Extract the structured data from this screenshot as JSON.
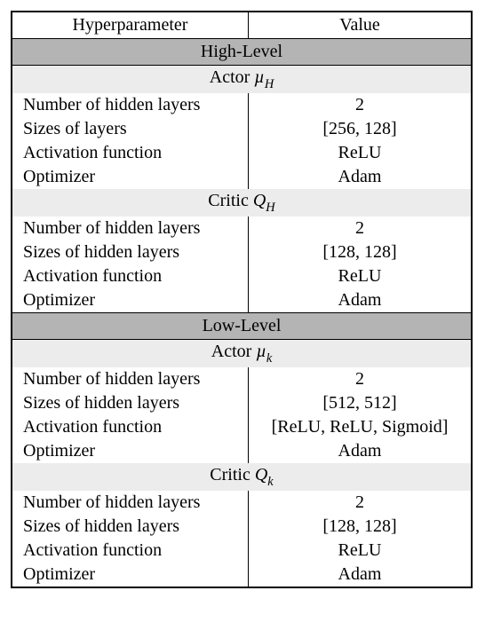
{
  "header": {
    "left": "Hyperparameter",
    "right": "Value"
  },
  "sections": [
    {
      "major": "High-Level",
      "groups": [
        {
          "minor_prefix": "Actor ",
          "minor_sym": "µ",
          "minor_sub": "H",
          "rows": [
            {
              "l": "Number of hidden layers",
              "r": "2"
            },
            {
              "l": "Sizes of layers",
              "r": "[256, 128]"
            },
            {
              "l": "Activation function",
              "r": "ReLU"
            },
            {
              "l": "Optimizer",
              "r": "Adam"
            }
          ]
        },
        {
          "minor_prefix": "Critic ",
          "minor_sym": "Q",
          "minor_sub": "H",
          "rows": [
            {
              "l": "Number of hidden layers",
              "r": "2"
            },
            {
              "l": "Sizes of hidden layers",
              "r": "[128, 128]"
            },
            {
              "l": "Activation function",
              "r": "ReLU"
            },
            {
              "l": "Optimizer",
              "r": "Adam"
            }
          ]
        }
      ]
    },
    {
      "major": "Low-Level",
      "groups": [
        {
          "minor_prefix": "Actor ",
          "minor_sym": "µ",
          "minor_sub": "k",
          "rows": [
            {
              "l": "Number of hidden layers",
              "r": "2"
            },
            {
              "l": "Sizes of hidden layers",
              "r": "[512, 512]"
            },
            {
              "l": "Activation function",
              "r": "[ReLU, ReLU, Sigmoid]"
            },
            {
              "l": "Optimizer",
              "r": "Adam"
            }
          ]
        },
        {
          "minor_prefix": "Critic ",
          "minor_sym": "Q",
          "minor_sub": "k",
          "rows": [
            {
              "l": "Number of hidden layers",
              "r": "2"
            },
            {
              "l": "Sizes of hidden layers",
              "r": "[128, 128]"
            },
            {
              "l": "Activation function",
              "r": "ReLU"
            },
            {
              "l": "Optimizer",
              "r": "Adam"
            }
          ]
        }
      ]
    }
  ]
}
